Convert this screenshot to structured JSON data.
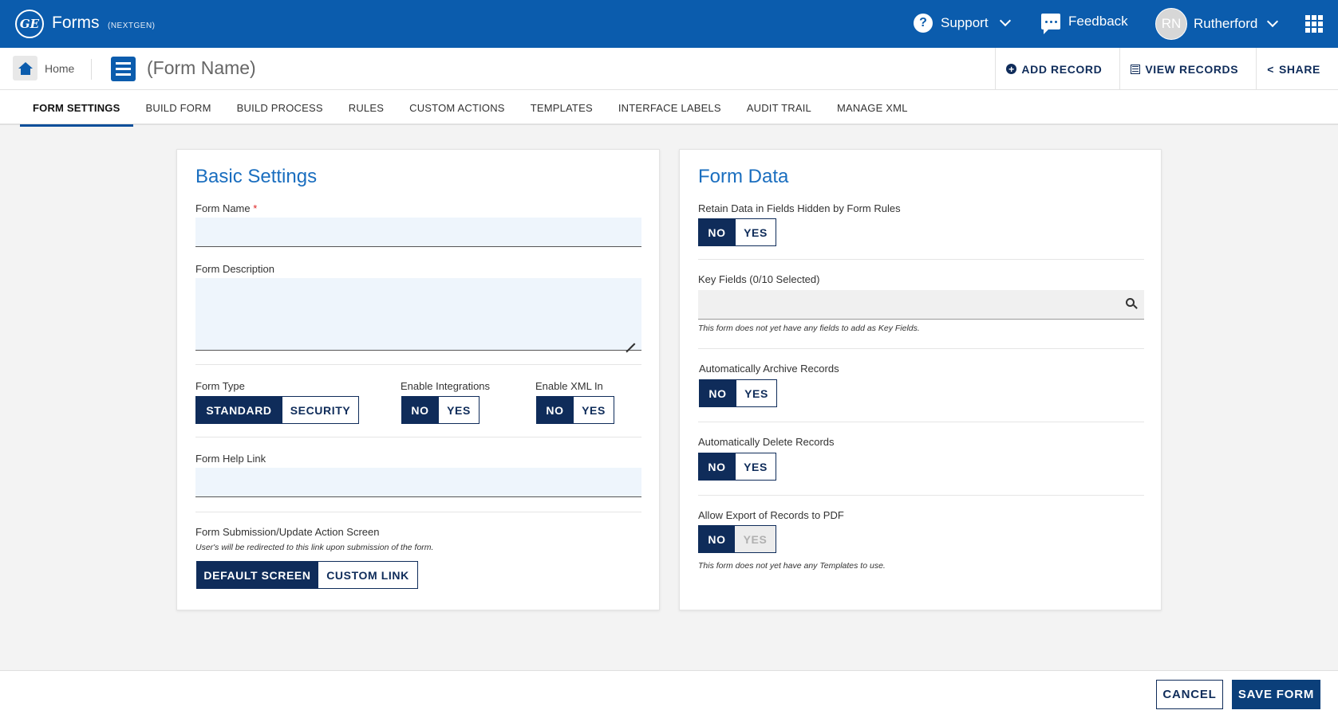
{
  "header": {
    "app_name": "Forms",
    "app_sub": "(NEXTGEN)",
    "logo_text": "GE",
    "support_label": "Support",
    "feedback_label": "Feedback",
    "user_initials": "RN",
    "user_name": "Rutherford"
  },
  "subbar": {
    "home_label": "Home",
    "form_name": "(Form Name)",
    "actions": {
      "add_record": "ADD RECORD",
      "view_records": "VIEW RECORDS",
      "share": "SHARE"
    }
  },
  "tabs": [
    {
      "label": "FORM SETTINGS",
      "active": true
    },
    {
      "label": "BUILD FORM"
    },
    {
      "label": "BUILD PROCESS"
    },
    {
      "label": "RULES"
    },
    {
      "label": "CUSTOM ACTIONS"
    },
    {
      "label": "TEMPLATES"
    },
    {
      "label": "INTERFACE LABELS"
    },
    {
      "label": "AUDIT TRAIL"
    },
    {
      "label": "MANAGE XML"
    }
  ],
  "basic": {
    "title": "Basic Settings",
    "form_name_label": "Form Name",
    "required_mark": "*",
    "form_name_value": "",
    "form_description_label": "Form Description",
    "form_description_value": "",
    "form_type_label": "Form Type",
    "form_type_options": [
      "STANDARD",
      "SECURITY"
    ],
    "form_type_selected": "STANDARD",
    "enable_integrations_label": "Enable Integrations",
    "enable_xml_label": "Enable XML In",
    "no": "NO",
    "yes": "YES",
    "help_link_label": "Form Help Link",
    "help_link_value": "",
    "submission_label": "Form Submission/Update Action Screen",
    "submission_hint": "User's will be redirected to this link upon submission of the form.",
    "submission_options": [
      "DEFAULT SCREEN",
      "CUSTOM LINK"
    ],
    "submission_selected": "DEFAULT SCREEN"
  },
  "formdata": {
    "title": "Form Data",
    "retain_label": "Retain Data in Fields Hidden by Form Rules",
    "key_fields_label": "Key Fields (0/10 Selected)",
    "key_fields_hint": "This form does not yet have any fields to add as Key Fields.",
    "archive_label": "Automatically Archive Records",
    "delete_label": "Automatically Delete Records",
    "export_label": "Allow Export of Records to PDF",
    "export_hint": "This form does not yet have any Templates to use."
  },
  "footer": {
    "cancel": "CANCEL",
    "save": "SAVE FORM"
  },
  "colors": {
    "brand_blue": "#0b5cad",
    "navy": "#0f2c5a",
    "title_blue": "#1a6ebf"
  }
}
